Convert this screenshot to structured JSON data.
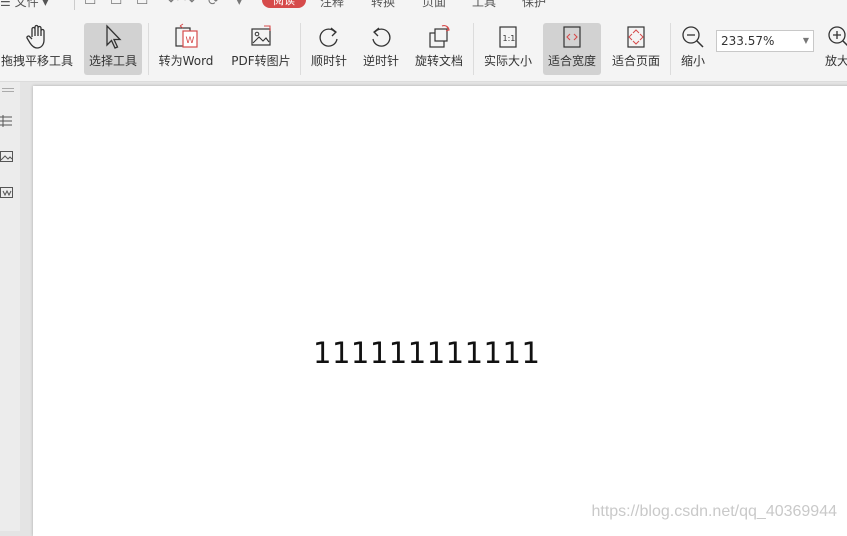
{
  "menubar": {
    "file_label": "文件",
    "active_tab": "阅读",
    "tabs": [
      "注释",
      "转换",
      "页面",
      "工具",
      "保护"
    ]
  },
  "toolbar": {
    "buttons": [
      {
        "label": "拖拽平移工具",
        "icon": "hand-icon"
      },
      {
        "label": "选择工具",
        "icon": "cursor-icon",
        "selected": true
      },
      {
        "label": "转为Word",
        "icon": "to-word-icon"
      },
      {
        "label": "PDF转图片",
        "icon": "pdf-to-image-icon"
      },
      {
        "label": "顺时针",
        "icon": "rotate-clockwise-icon"
      },
      {
        "label": "逆时针",
        "icon": "rotate-counterclockwise-icon"
      },
      {
        "label": "旋转文档",
        "icon": "rotate-document-icon"
      },
      {
        "label": "实际大小",
        "icon": "actual-size-icon"
      },
      {
        "label": "适合宽度",
        "icon": "fit-width-icon",
        "selected": true
      },
      {
        "label": "适合页面",
        "icon": "fit-page-icon"
      },
      {
        "label": "缩小",
        "icon": "zoom-out-icon"
      },
      {
        "label": "放大",
        "icon": "zoom-in-icon"
      }
    ],
    "zoom_value": "233.57%"
  },
  "document": {
    "text": "111111111111"
  },
  "watermark": "https://blog.csdn.net/qq_40369944",
  "colors": {
    "active_tab": "#d64b4b",
    "selected_button": "#d2d2d2",
    "toolbar_bg": "#f4f4f4"
  }
}
